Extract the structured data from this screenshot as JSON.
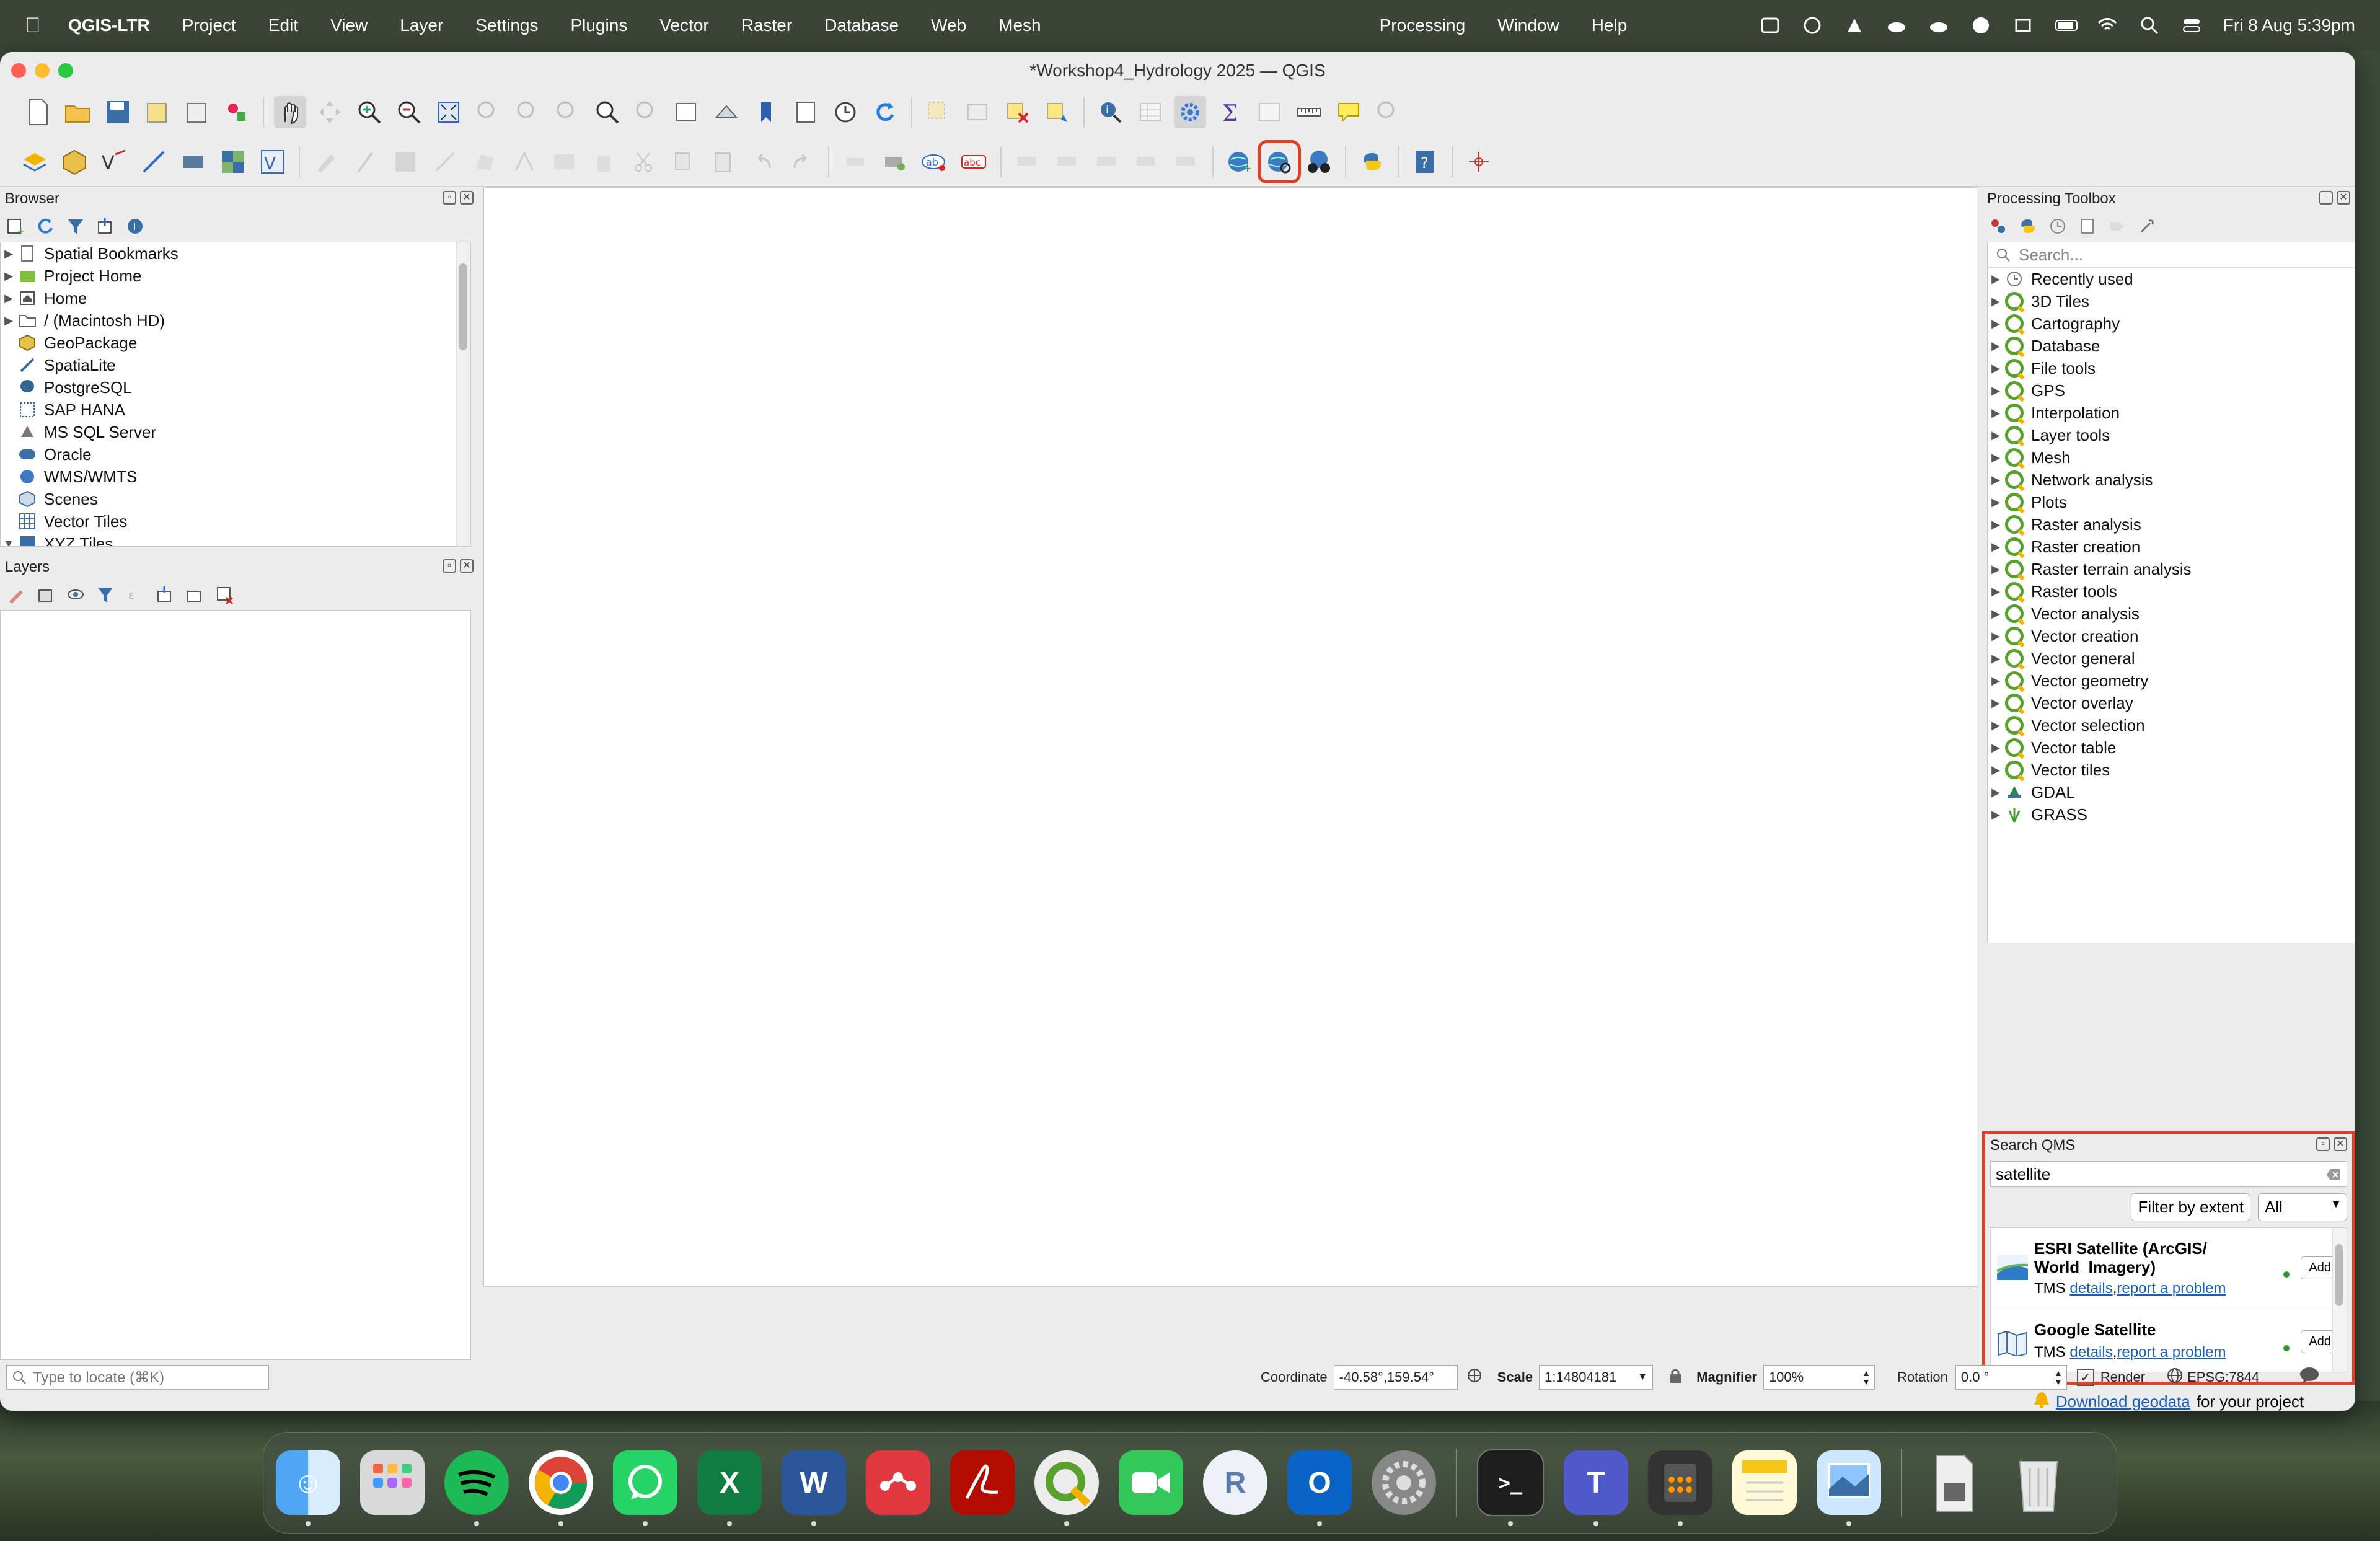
{
  "menubar": {
    "app": "QGIS-LTR",
    "items": [
      "Project",
      "Edit",
      "View",
      "Layer",
      "Settings",
      "Plugins",
      "Vector",
      "Raster",
      "Database",
      "Web",
      "Mesh"
    ],
    "right_items": [
      "Processing",
      "Window",
      "Help"
    ],
    "clock": "Fri 8 Aug  5:39pm"
  },
  "window": {
    "title": "*Workshop4_Hydrology 2025 — QGIS"
  },
  "browser": {
    "title": "Browser",
    "items": [
      {
        "label": "Spatial Bookmarks",
        "icon": "bookmark-icon"
      },
      {
        "label": "Project Home",
        "icon": "project-home-icon"
      },
      {
        "label": "Home",
        "icon": "home-icon"
      },
      {
        "label": "/ (Macintosh HD)",
        "icon": "folder-icon"
      },
      {
        "label": "GeoPackage",
        "icon": "geopackage-icon"
      },
      {
        "label": "SpatiaLite",
        "icon": "spatialite-icon"
      },
      {
        "label": "PostgreSQL",
        "icon": "postgresql-icon"
      },
      {
        "label": "SAP HANA",
        "icon": "sap-hana-icon"
      },
      {
        "label": "MS SQL Server",
        "icon": "mssql-icon"
      },
      {
        "label": "Oracle",
        "icon": "oracle-icon"
      },
      {
        "label": "WMS/WMTS",
        "icon": "wms-icon"
      },
      {
        "label": "Scenes",
        "icon": "scenes-icon"
      },
      {
        "label": "Vector Tiles",
        "icon": "vector-tiles-icon"
      },
      {
        "label": "XYZ Tiles",
        "icon": "xyz-tiles-icon"
      }
    ]
  },
  "layers": {
    "title": "Layers"
  },
  "toolbox": {
    "title": "Processing Toolbox",
    "search_placeholder": "Search...",
    "items": [
      "Recently used",
      "3D Tiles",
      "Cartography",
      "Database",
      "File tools",
      "GPS",
      "Interpolation",
      "Layer tools",
      "Mesh",
      "Network analysis",
      "Plots",
      "Raster analysis",
      "Raster creation",
      "Raster terrain analysis",
      "Raster tools",
      "Vector analysis",
      "Vector creation",
      "Vector general",
      "Vector geometry",
      "Vector overlay",
      "Vector selection",
      "Vector table",
      "Vector tiles",
      "GDAL",
      "GRASS"
    ]
  },
  "qms": {
    "title": "Search QMS",
    "search_value": "satellite",
    "filter_label": "Filter by extent",
    "select_value": "All",
    "results": [
      {
        "title": "ESRI Satellite (ArcGIS/ World_Imagery)",
        "type": "TMS",
        "details": "details",
        "report": "report a problem",
        "add": "Add"
      },
      {
        "title": "Google Satellite",
        "type": "TMS",
        "details": "details",
        "report": "report a problem",
        "add": "Add"
      }
    ],
    "download_link": "Download geodata",
    "download_suffix": "for your project"
  },
  "statusbar": {
    "locate_placeholder": "Type to locate (⌘K)",
    "coordinate_label": "Coordinate",
    "coordinate_value": "-40.58°,159.54°",
    "scale_label": "Scale",
    "scale_value": "1:14804181",
    "magnifier_label": "Magnifier",
    "magnifier_value": "100%",
    "rotation_label": "Rotation",
    "rotation_value": "0.0 °",
    "render_label": "Render",
    "crs": "EPSG:7844"
  },
  "dock": [
    "Finder",
    "Launchpad",
    "Spotify",
    "Chrome",
    "WhatsApp",
    "Excel",
    "Word",
    "Mendeley",
    "Acrobat",
    "QGIS",
    "FaceTime",
    "R",
    "Outlook",
    "System Settings",
    "Terminal",
    "Teams",
    "Calculator",
    "Notes",
    "Preview",
    "Archive",
    "Trash"
  ],
  "colors": {
    "highlight": "#e0402a",
    "qgis_green": "#5aa02c",
    "link": "#1a5fb4"
  }
}
